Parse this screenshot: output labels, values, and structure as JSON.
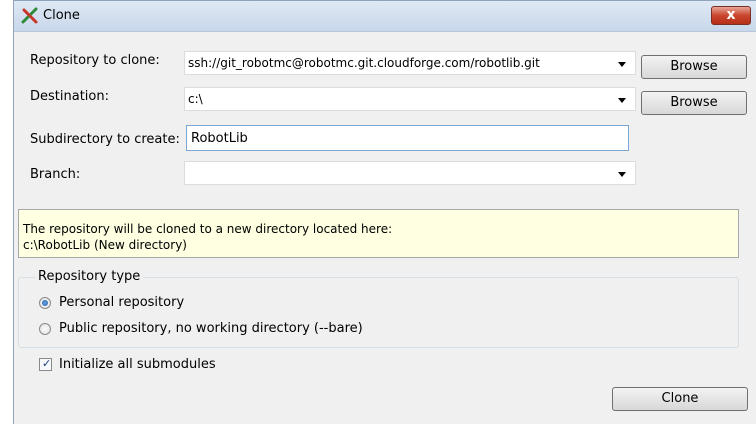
{
  "window": {
    "title": "Clone",
    "close_glyph": "x"
  },
  "repository": {
    "label": "Repository to clone:",
    "value": "ssh://git_robotmc@robotmc.git.cloudforge.com/robotlib.git",
    "browse": "Browse"
  },
  "destination": {
    "label": "Destination:",
    "value": "c:\\",
    "browse": "Browse"
  },
  "subdirectory": {
    "label": "Subdirectory to create:",
    "value": "RobotLib"
  },
  "branch": {
    "label": "Branch:",
    "value": ""
  },
  "info": {
    "line1": "The repository will be cloned to a new directory located here:",
    "line2": "c:\\RobotLib (New directory)"
  },
  "repo_type": {
    "legend": "Repository type",
    "personal": {
      "label": "Personal repository",
      "checked": true
    },
    "public": {
      "label": "Public repository, no working directory  (--bare)",
      "checked": false
    }
  },
  "submodules": {
    "label": "Initialize all submodules",
    "checked": true
  },
  "actions": {
    "clone": "Clone"
  },
  "icons": {
    "title": "clone-app-icon",
    "close": "close-icon",
    "dropdown": "chevron-down-icon"
  }
}
